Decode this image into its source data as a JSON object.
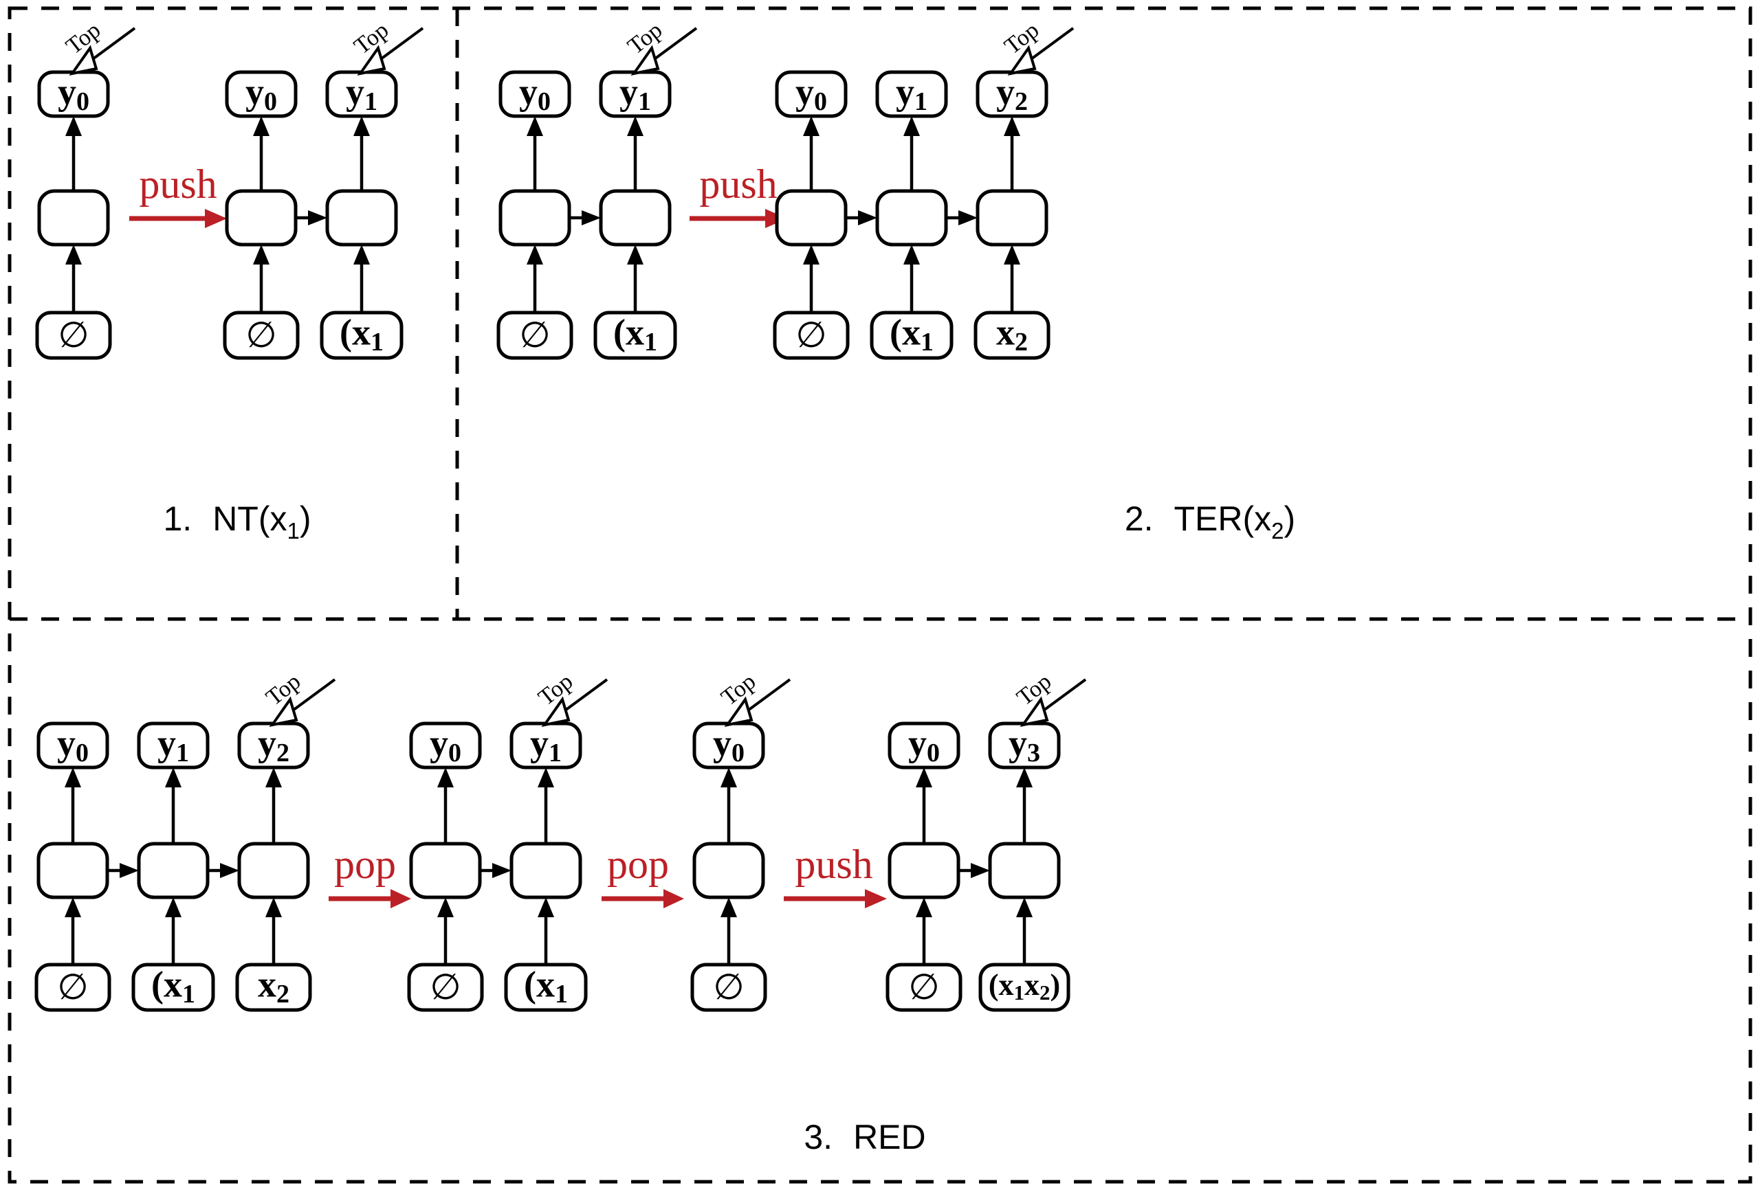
{
  "figure": {
    "title": "Stack-LSTM transition diagram",
    "colors": {
      "stroke": "#000000",
      "background": "#ffffff",
      "operation_red": "#bb2026"
    },
    "top_annotation_label": "Top",
    "empty_stack_symbol": "∅"
  },
  "panels": [
    {
      "id": "panel-1",
      "caption_number": "1.",
      "caption_text": "NT(x",
      "caption_sub": "1",
      "caption_tail": ")",
      "caption_full": "1.  NT(x1)",
      "operations": [
        {
          "label": "push"
        }
      ],
      "stacks": [
        {
          "id": "stack-1-a",
          "top_marked_index": 0,
          "cells": [
            {
              "output": "y",
              "output_sub": "0",
              "input": "∅",
              "input_kind": "empty-set"
            }
          ]
        },
        {
          "id": "stack-1-b",
          "top_marked_index": 1,
          "cells": [
            {
              "output": "y",
              "output_sub": "0",
              "input": "∅",
              "input_kind": "empty-set"
            },
            {
              "output": "y",
              "output_sub": "1",
              "input": "(x",
              "input_sub": "1",
              "input_kind": "open-nonterminal"
            }
          ]
        }
      ]
    },
    {
      "id": "panel-2",
      "caption_number": "2.",
      "caption_text": "TER(x",
      "caption_sub": "2",
      "caption_tail": ")",
      "caption_full": "2.  TER(x2)",
      "operations": [
        {
          "label": "push"
        }
      ],
      "stacks": [
        {
          "id": "stack-2-a",
          "top_marked_index": 1,
          "cells": [
            {
              "output": "y",
              "output_sub": "0",
              "input": "∅",
              "input_kind": "empty-set"
            },
            {
              "output": "y",
              "output_sub": "1",
              "input": "(x",
              "input_sub": "1",
              "input_kind": "open-nonterminal"
            }
          ]
        },
        {
          "id": "stack-2-b",
          "top_marked_index": 2,
          "cells": [
            {
              "output": "y",
              "output_sub": "0",
              "input": "∅",
              "input_kind": "empty-set"
            },
            {
              "output": "y",
              "output_sub": "1",
              "input": "(x",
              "input_sub": "1",
              "input_kind": "open-nonterminal"
            },
            {
              "output": "y",
              "output_sub": "2",
              "input": "x",
              "input_sub": "2",
              "input_kind": "terminal"
            }
          ]
        }
      ]
    },
    {
      "id": "panel-3",
      "caption_number": "3.",
      "caption_text": "RED",
      "caption_sub": "",
      "caption_tail": "",
      "caption_full": "3.  RED",
      "operations": [
        {
          "label": "pop"
        },
        {
          "label": "pop"
        },
        {
          "label": "push"
        }
      ],
      "stacks": [
        {
          "id": "stack-3-a",
          "top_marked_index": 2,
          "cells": [
            {
              "output": "y",
              "output_sub": "0",
              "input": "∅",
              "input_kind": "empty-set"
            },
            {
              "output": "y",
              "output_sub": "1",
              "input": "(x",
              "input_sub": "1",
              "input_kind": "open-nonterminal"
            },
            {
              "output": "y",
              "output_sub": "2",
              "input": "x",
              "input_sub": "2",
              "input_kind": "terminal"
            }
          ]
        },
        {
          "id": "stack-3-b",
          "top_marked_index": 1,
          "cells": [
            {
              "output": "y",
              "output_sub": "0",
              "input": "∅",
              "input_kind": "empty-set"
            },
            {
              "output": "y",
              "output_sub": "1",
              "input": "(x",
              "input_sub": "1",
              "input_kind": "open-nonterminal"
            }
          ]
        },
        {
          "id": "stack-3-c",
          "top_marked_index": 0,
          "cells": [
            {
              "output": "y",
              "output_sub": "0",
              "input": "∅",
              "input_kind": "empty-set"
            }
          ]
        },
        {
          "id": "stack-3-d",
          "top_marked_index": 1,
          "cells": [
            {
              "output": "y",
              "output_sub": "0",
              "input": "∅",
              "input_kind": "empty-set"
            },
            {
              "output": "y",
              "output_sub": "3",
              "input": "(x1x2)",
              "input_kind": "reduced-constituent"
            }
          ]
        }
      ]
    }
  ]
}
